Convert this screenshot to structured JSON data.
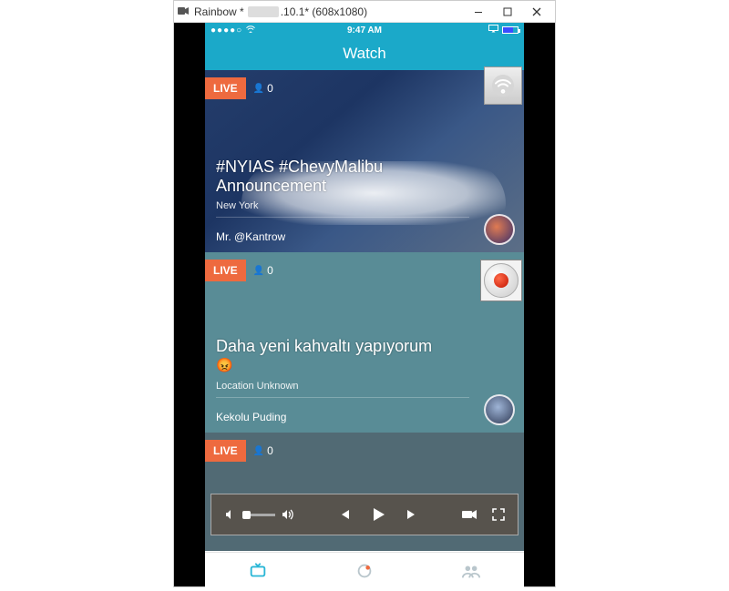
{
  "window": {
    "title_prefix": "Rainbow *",
    "title_suffix": ".10.1* (608x1080)"
  },
  "statusbar": {
    "time": "9:47 AM"
  },
  "app": {
    "header_title": "Watch"
  },
  "feed": [
    {
      "live": "LIVE",
      "viewers": "0",
      "title": "#NYIAS #ChevyMalibu Announcement",
      "location": "New York",
      "user": "Mr. @Kantrow"
    },
    {
      "live": "LIVE",
      "viewers": "0",
      "title": "Daha yeni kahvaltı yapıyorum",
      "emoji": "😡",
      "location": "Location Unknown",
      "user": "Kekolu Puding"
    },
    {
      "live": "LIVE",
      "viewers": "0"
    }
  ]
}
